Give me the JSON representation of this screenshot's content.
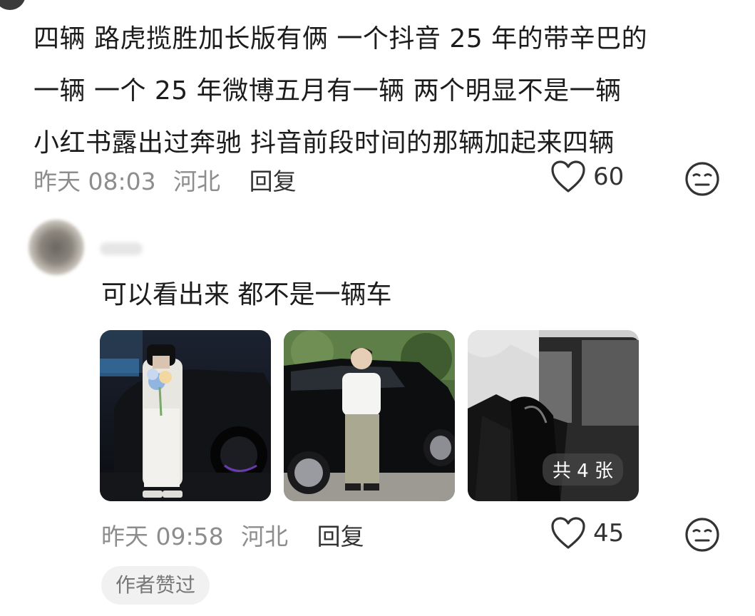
{
  "comment1": {
    "lines": [
      "四辆 路虎揽胜加长版有俩 一个抖音 25 年的带辛巴的",
      "一辆  一个 25 年微博五月有一辆 两个明显不是一辆",
      "小红书露出过奔驰 抖音前段时间的那辆加起来四辆"
    ],
    "time": "昨天 08:03",
    "location": "河北",
    "reply_label": "回复",
    "like_count": "60",
    "icons": {
      "like": "heart-icon",
      "reaction": "neutral-face-icon"
    }
  },
  "comment2": {
    "text": "可以看出来 都不是一辆车",
    "time": "昨天 09:58",
    "location": "河北",
    "reply_label": "回复",
    "like_count": "45",
    "image_count_badge": "共 4 张",
    "author_liked_label": "作者赞过",
    "icons": {
      "like": "heart-icon",
      "reaction": "neutral-face-icon"
    }
  },
  "colors": {
    "text": "#1c1c1c",
    "meta": "#8d8d8d",
    "badge_bg": "#f1f1f1"
  }
}
